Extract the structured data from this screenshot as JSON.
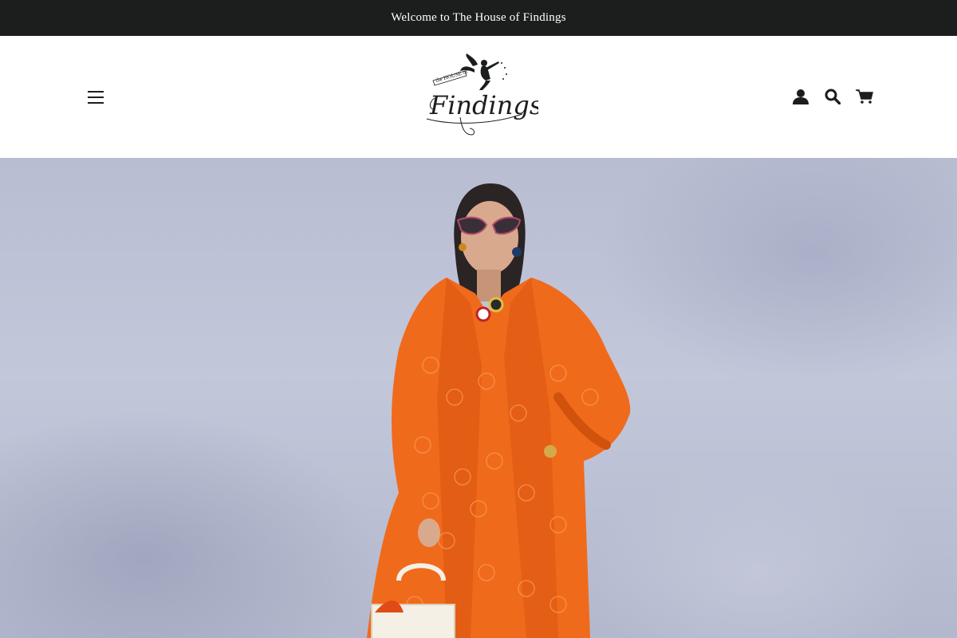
{
  "announcement": {
    "text": "Welcome to The House of Findings"
  },
  "header": {
    "logo_small_text": "the HOUSE of",
    "logo_main_text": "Findings"
  },
  "icons": {
    "menu": "hamburger-menu-icon",
    "account": "user-account-icon",
    "search": "search-icon",
    "cart": "shopping-cart-icon"
  },
  "colors": {
    "announcement_bg": "#1c1d1d",
    "header_text": "#1c1d1d",
    "hero_wall": "#bcc0d5",
    "coat": "#f06a1c"
  }
}
